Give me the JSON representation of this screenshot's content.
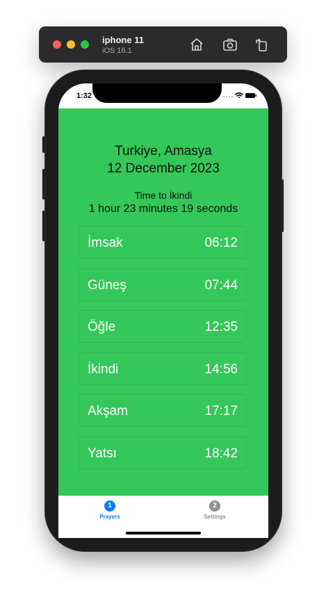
{
  "toolbar": {
    "device_name": "iphone 11",
    "os_version": "iOS 16.1",
    "home_icon": "home-icon",
    "screenshot_icon": "camera-icon",
    "rotate_icon": "rotate-icon"
  },
  "status_bar": {
    "time": "1:32"
  },
  "header": {
    "location": "Turkiye, Amasya",
    "date": "12 December 2023",
    "next_prayer_label": "Time to İkindi",
    "countdown": "1 hour 23 minutes 19 seconds"
  },
  "prayers": [
    {
      "name": "İmsak",
      "time": "06:12"
    },
    {
      "name": "Güneş",
      "time": "07:44"
    },
    {
      "name": "Öğle",
      "time": "12:35"
    },
    {
      "name": "İkindi",
      "time": "14:56"
    },
    {
      "name": "Akşam",
      "time": "17:17"
    },
    {
      "name": "Yatsı",
      "time": "18:42"
    }
  ],
  "tabs": [
    {
      "badge": "1",
      "label": "Prayers"
    },
    {
      "badge": "2",
      "label": "Settings"
    }
  ],
  "colors": {
    "background_green": "#34c759",
    "active_tab": "#0a7cff",
    "inactive_tab": "#8e8e93"
  }
}
